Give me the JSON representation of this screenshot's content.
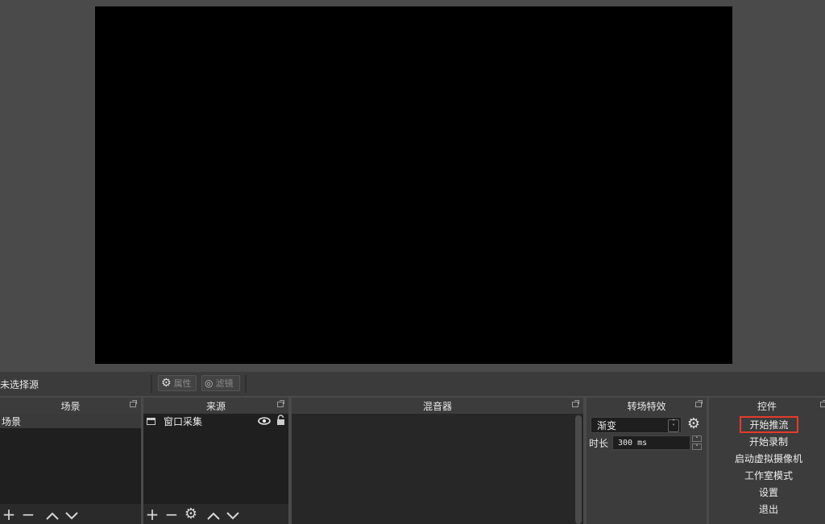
{
  "context": {
    "no_source": "未选择源",
    "properties": "属性",
    "filters": "滤镜"
  },
  "docks": {
    "scenes": {
      "title": "场景",
      "items": [
        "场景"
      ]
    },
    "sources": {
      "title": "来源",
      "items": [
        "窗口采集"
      ]
    },
    "mixer": {
      "title": "混音器"
    },
    "transitions": {
      "title": "转场特效",
      "selected": "渐变",
      "duration_label": "时长",
      "duration_value": "300 ms"
    },
    "controls": {
      "title": "控件",
      "buttons": [
        "开始推流",
        "开始录制",
        "启动虚拟摄像机",
        "工作室模式",
        "设置",
        "退出"
      ]
    }
  },
  "icons": {
    "add": "plus-icon",
    "remove": "minus-icon",
    "up": "chevron-up-icon",
    "down": "chevron-down-icon",
    "gear": "gear-icon",
    "eye": "eye-icon",
    "lock": "lock-icon",
    "window": "window-icon"
  },
  "colors": {
    "highlight": "#e53b2c",
    "preview": "#000000"
  }
}
